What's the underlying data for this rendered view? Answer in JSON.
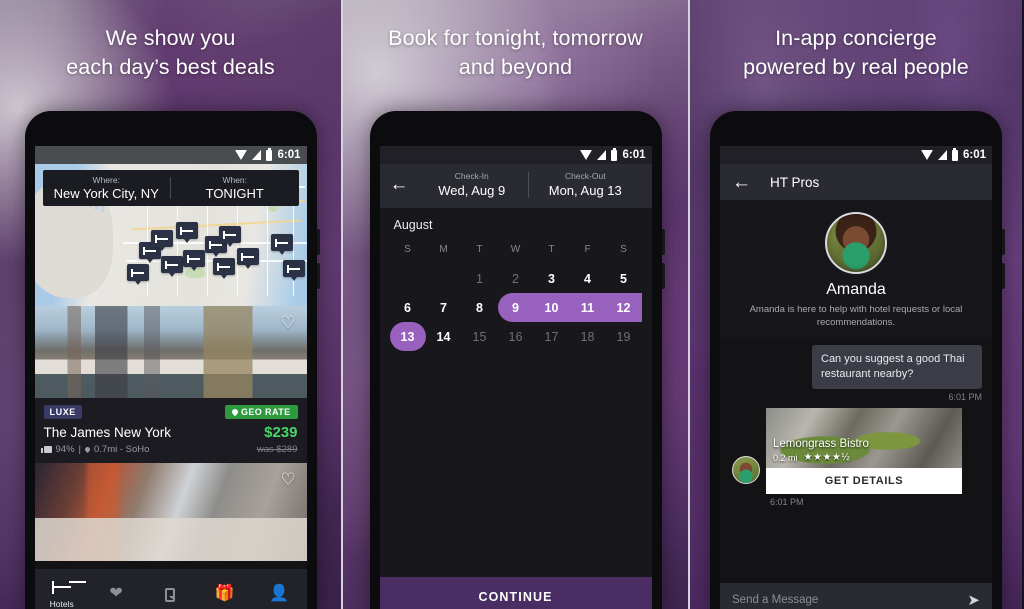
{
  "panels": [
    {
      "headline_line1": "We show you",
      "headline_line2": "each day’s best deals",
      "status_bar": {
        "time": "6:01",
        "wifi_icon": "wifi-icon",
        "signal_icon": "signal-icon",
        "battery_icon": "battery-icon"
      },
      "search_bar": {
        "where_label": "Where:",
        "where_value": "New York City, NY",
        "when_label": "When:",
        "when_value": "TONIGHT"
      },
      "map": {
        "pin_icon": "bed-pin-icon",
        "pin_count": 12
      },
      "hotel": {
        "badge_luxe": "LUXE",
        "badge_geo": "GEO RATE",
        "geo_icon": "location-pin-icon",
        "name": "The James New York",
        "price": "$239",
        "rating": "94%",
        "thumb_icon": "thumbs-up-icon",
        "distance": "0.7mi - SoHo",
        "distance_icon": "location-pin-icon",
        "was_price": "was $289",
        "favorite_icon": "heart-icon"
      },
      "hotel2": {
        "favorite_icon": "heart-icon"
      },
      "bottom_nav": [
        {
          "label": "Hotels",
          "icon": "bed-icon",
          "active": true
        },
        {
          "label": "",
          "icon": "heart-icon",
          "active": false
        },
        {
          "label": "",
          "icon": "phone-deals-icon",
          "active": false
        },
        {
          "label": "",
          "icon": "gift-icon",
          "active": false
        },
        {
          "label": "",
          "icon": "profile-icon",
          "active": false
        }
      ]
    },
    {
      "headline_line1": "Book for tonight, tomorrow",
      "headline_line2": "and beyond",
      "status_bar": {
        "time": "6:01",
        "wifi_icon": "wifi-icon",
        "signal_icon": "signal-icon",
        "battery_icon": "battery-icon"
      },
      "back_icon": "back-arrow-icon",
      "checkin_label": "Check-In",
      "checkin_value": "Wed, Aug 9",
      "checkout_label": "Check-Out",
      "checkout_value": "Mon, Aug 13",
      "calendar": {
        "month": "August",
        "weekdays": [
          "S",
          "M",
          "T",
          "W",
          "T",
          "F",
          "S"
        ],
        "leading_blanks": 2,
        "days": [
          {
            "n": "1",
            "state": "dim"
          },
          {
            "n": "2",
            "state": "dim"
          },
          {
            "n": "3",
            "state": "bright"
          },
          {
            "n": "4",
            "state": "bright"
          },
          {
            "n": "5",
            "state": "bright"
          },
          {
            "n": "6",
            "state": "bright"
          },
          {
            "n": "7",
            "state": "bright"
          },
          {
            "n": "8",
            "state": "bright"
          },
          {
            "n": "9",
            "state": "selected-start"
          },
          {
            "n": "10",
            "state": "selected-mid"
          },
          {
            "n": "11",
            "state": "selected-mid"
          },
          {
            "n": "12",
            "state": "selected-mid"
          },
          {
            "n": "13",
            "state": "selected-end"
          },
          {
            "n": "14",
            "state": "bright"
          },
          {
            "n": "15",
            "state": "dim"
          },
          {
            "n": "16",
            "state": "dim"
          },
          {
            "n": "17",
            "state": "dim"
          },
          {
            "n": "18",
            "state": "dim"
          },
          {
            "n": "19",
            "state": "dim"
          }
        ]
      },
      "continue_label": "CONTINUE"
    },
    {
      "headline_line1": "In-app concierge",
      "headline_line2": "powered by real people",
      "status_bar": {
        "time": "6:01",
        "wifi_icon": "wifi-icon",
        "signal_icon": "signal-icon",
        "battery_icon": "battery-icon"
      },
      "back_icon": "back-arrow-icon",
      "app_title": "HT Pros",
      "agent_name": "Amanda",
      "agent_desc": "Amanda is here to help with hotel requests or local recommendations.",
      "avatar_icon": "agent-avatar",
      "message_out": "Can you suggest a good Thai restaurant nearby?",
      "message_out_time": "6:01 PM",
      "restaurant": {
        "name": "Lemongrass Bistro",
        "distance": "0.2 mi",
        "stars": "★★★★½",
        "details_label": "GET DETAILS"
      },
      "message_in_time": "6:01 PM",
      "composer_placeholder": "Send a Message",
      "send_icon": "send-icon"
    }
  ],
  "colors": {
    "accent_purple": "#9761bd",
    "continue_purple": "#4a2d63",
    "price_green": "#4ad46a",
    "geo_green": "#2e9a3e",
    "luxe_indigo": "#3a3a66",
    "screen_dark": "#131316",
    "bar_dark": "#2a2a32"
  }
}
